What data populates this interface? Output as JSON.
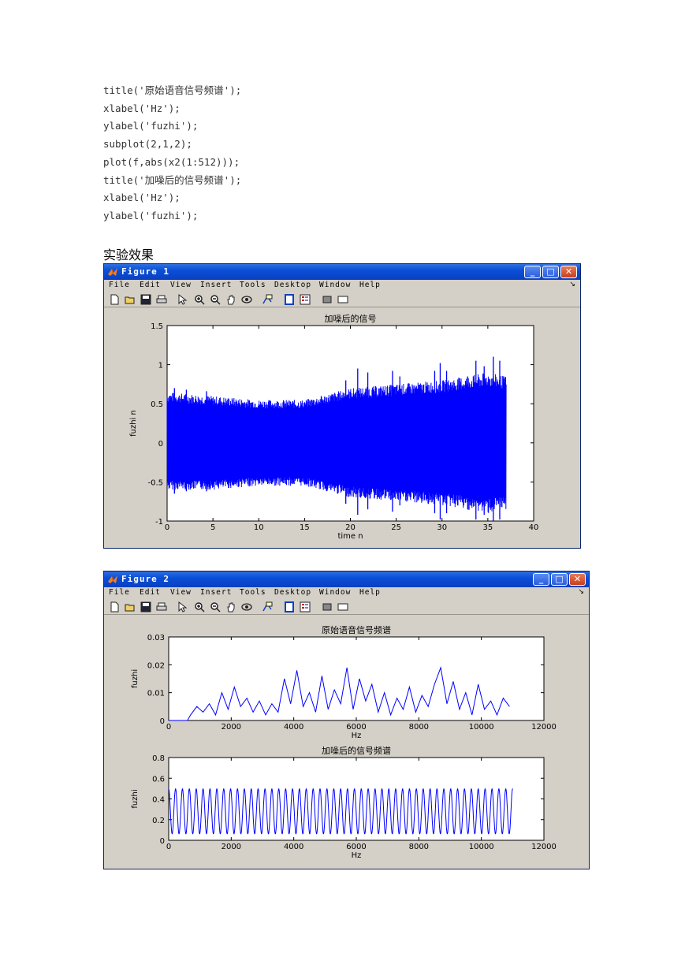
{
  "code_lines": [
    "title('原始语音信号频谱');",
    "xlabel('Hz');",
    "ylabel('fuzhi');",
    "subplot(2,1,2);",
    "plot(f,abs(x2(1:512)));",
    "title('加噪后的信号频谱');",
    "xlabel('Hz');",
    "ylabel('fuzhi');"
  ],
  "section_heading": "实验效果",
  "menu_items": [
    "File",
    "Edit",
    "View",
    "Insert",
    "Tools",
    "Desktop",
    "Window",
    "Help"
  ],
  "colors": {
    "plot_line": "#0000ff",
    "window_bg": "#d4d0c8",
    "title_bar": "#0a4fd8"
  },
  "figure1": {
    "title": "Figure 1",
    "toolbar_icons": [
      "new-file-icon",
      "open-folder-icon",
      "save-icon",
      "print-icon",
      "pointer-icon",
      "zoom-in-icon",
      "zoom-out-icon",
      "pan-icon",
      "rotate-icon",
      "data-cursor-icon",
      "colorbar-icon",
      "legend-icon",
      "hide-plot-tools-icon",
      "show-plot-tools-icon"
    ],
    "chart_data": {
      "type": "line",
      "title": "加噪后的信号",
      "xlabel": "time n",
      "ylabel": "fuzhi n",
      "xlim": [
        0,
        40
      ],
      "ylim": [
        -1,
        1.5
      ],
      "xticks": [
        "0",
        "5",
        "10",
        "15",
        "20",
        "25",
        "30",
        "35",
        "40"
      ],
      "yticks": [
        "-1",
        "-0.5",
        "0",
        "0.5",
        "1",
        "1.5"
      ],
      "signal_end_x": 37,
      "envelope": {
        "x": [
          0,
          5,
          10,
          15,
          20,
          25,
          30,
          35,
          37
        ],
        "upper": [
          0.65,
          0.6,
          0.55,
          0.55,
          0.7,
          0.75,
          0.8,
          0.9,
          0.85
        ],
        "lower": [
          -0.6,
          -0.6,
          -0.55,
          -0.55,
          -0.7,
          -0.75,
          -0.8,
          -0.9,
          -0.85
        ]
      },
      "peaks": {
        "x": [
          0.8,
          2.1,
          4.3,
          19.5,
          20.8,
          21.9,
          24.6,
          25.4,
          29.2,
          29.8,
          30.5,
          32.8,
          33.7,
          34.6,
          35.6,
          36.3
        ],
        "upper": [
          0.7,
          0.68,
          0.66,
          0.8,
          0.95,
          0.9,
          0.92,
          0.85,
          0.92,
          1.02,
          0.92,
          0.85,
          1.05,
          0.98,
          1.1,
          1.05
        ],
        "lower": [
          -0.65,
          -0.62,
          -0.62,
          -0.78,
          -0.92,
          -0.85,
          -0.88,
          -0.8,
          -0.9,
          -0.98,
          -0.9,
          -0.85,
          -0.98,
          -0.92,
          -1.0,
          -0.98
        ]
      },
      "grid": false
    }
  },
  "figure2": {
    "title": "Figure 2",
    "chart_data": [
      {
        "type": "line",
        "title": "原始语音信号频谱",
        "xlabel": "Hz",
        "ylabel": "fuzhi",
        "xlim": [
          0,
          12000
        ],
        "ylim": [
          0,
          0.03
        ],
        "xticks": [
          "0",
          "2000",
          "4000",
          "6000",
          "8000",
          "10000",
          "12000"
        ],
        "yticks": [
          "0",
          "0.01",
          "0.02",
          "0.03"
        ],
        "x": [
          0,
          600,
          700,
          900,
          1100,
          1300,
          1500,
          1700,
          1900,
          2100,
          2300,
          2500,
          2700,
          2900,
          3100,
          3300,
          3500,
          3700,
          3900,
          4100,
          4300,
          4500,
          4700,
          4900,
          5100,
          5300,
          5500,
          5700,
          5900,
          6100,
          6300,
          6500,
          6700,
          6900,
          7100,
          7300,
          7500,
          7700,
          7900,
          8100,
          8300,
          8500,
          8700,
          8900,
          9100,
          9300,
          9500,
          9700,
          9900,
          10100,
          10300,
          10500,
          10700,
          10900
        ],
        "y": [
          0,
          0,
          0.002,
          0.005,
          0.003,
          0.006,
          0.002,
          0.01,
          0.004,
          0.012,
          0.005,
          0.008,
          0.003,
          0.007,
          0.002,
          0.006,
          0.003,
          0.015,
          0.006,
          0.018,
          0.005,
          0.01,
          0.003,
          0.016,
          0.004,
          0.011,
          0.006,
          0.019,
          0.004,
          0.015,
          0.007,
          0.013,
          0.003,
          0.01,
          0.002,
          0.008,
          0.004,
          0.012,
          0.003,
          0.009,
          0.005,
          0.013,
          0.019,
          0.006,
          0.014,
          0.004,
          0.01,
          0.002,
          0.013,
          0.004,
          0.007,
          0.002,
          0.008,
          0.005
        ],
        "grid": false
      },
      {
        "type": "line",
        "title": "加噪后的信号频谱",
        "xlabel": "Hz",
        "ylabel": "fuzhi",
        "xlim": [
          0,
          12000
        ],
        "ylim": [
          0,
          0.8
        ],
        "xticks": [
          "0",
          "2000",
          "4000",
          "6000",
          "8000",
          "10000",
          "12000"
        ],
        "yticks": [
          "0",
          "0.2",
          "0.4",
          "0.6",
          "0.8"
        ],
        "oscillation": {
          "x_start": 0,
          "x_end": 11000,
          "cycles": 50,
          "min": 0.06,
          "max": 0.5
        },
        "grid": false
      }
    ]
  }
}
